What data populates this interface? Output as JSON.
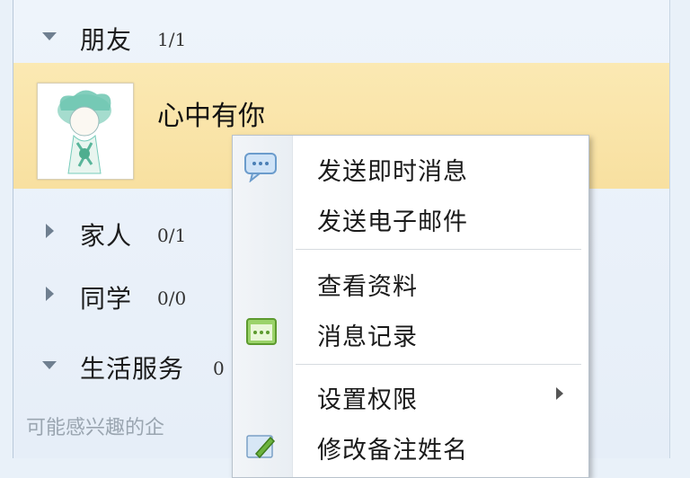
{
  "groups": [
    {
      "name": "朋友",
      "count": "1/1",
      "expanded": true
    },
    {
      "name": "家人",
      "count": "0/1",
      "expanded": false
    },
    {
      "name": "同学",
      "count": "0/0",
      "expanded": false
    },
    {
      "name": "生活服务",
      "count": "0",
      "expanded": true
    }
  ],
  "contact": {
    "name": "心中有你",
    "highlight_color": "#f9e4a6"
  },
  "hint_text": "可能感兴趣的企",
  "context_menu": {
    "items": [
      {
        "label": "发送即时消息",
        "icon": "chat-bubble-icon"
      },
      {
        "label": "发送电子邮件",
        "icon": ""
      },
      {
        "label": "查看资料",
        "icon": ""
      },
      {
        "label": "消息记录",
        "icon": "message-log-icon"
      },
      {
        "label": "设置权限",
        "icon": "",
        "has_submenu": true
      },
      {
        "label": "修改备注姓名",
        "icon": "edit-pencil-icon"
      }
    ]
  }
}
